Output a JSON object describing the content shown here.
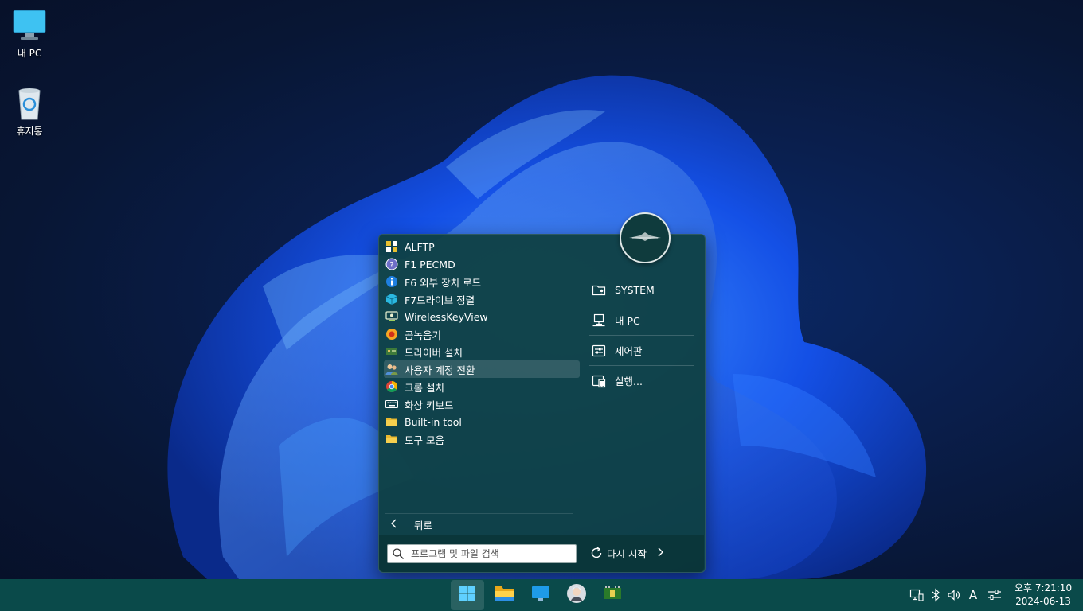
{
  "desktop": {
    "icons": [
      {
        "label": "내 PC",
        "icon": "monitor-icon"
      },
      {
        "label": "휴지통",
        "icon": "recycle-bin-icon"
      }
    ]
  },
  "start_menu": {
    "programs": [
      {
        "label": "ALFTP",
        "icon": "alftp-icon"
      },
      {
        "label": "F1 PECMD",
        "icon": "help-icon"
      },
      {
        "label": "F6 외부 장치 로드",
        "icon": "info-icon"
      },
      {
        "label": "F7드라이브 정렬",
        "icon": "cube-icon"
      },
      {
        "label": "WirelessKeyView",
        "icon": "wireless-key-icon"
      },
      {
        "label": "곰녹음기",
        "icon": "recorder-icon"
      },
      {
        "label": "드라이버 설치",
        "icon": "driver-icon"
      },
      {
        "label": "사용자 계정 전환",
        "icon": "users-icon"
      },
      {
        "label": "크롬 설치",
        "icon": "chrome-icon"
      },
      {
        "label": "화상 키보드",
        "icon": "keyboard-icon"
      },
      {
        "label": "Built-in tool",
        "icon": "folder-icon"
      },
      {
        "label": "도구 모음",
        "icon": "folder-icon"
      }
    ],
    "highlighted_index": 7,
    "right_items": [
      {
        "label": "SYSTEM",
        "icon": "user-folder-icon"
      },
      {
        "label": "내 PC",
        "icon": "computer-icon"
      },
      {
        "label": "제어판",
        "icon": "control-panel-icon"
      },
      {
        "label": "실행...",
        "icon": "run-icon"
      }
    ],
    "back_label": "뒤로",
    "search_placeholder": "프로그램 및 파일 검색",
    "restart_label": "다시 시작"
  },
  "taskbar": {
    "apps": [
      "start-button",
      "file-explorer",
      "desktop-app",
      "user-app",
      "hardware-app"
    ],
    "clock": {
      "time": "오후 7:21:10",
      "date": "2024-06-13"
    },
    "tray": [
      "network-icon",
      "bluetooth-icon",
      "volume-icon",
      "ime-indicator",
      "settings-sliders-icon"
    ],
    "ime_text": "A"
  },
  "colors": {
    "menu_bg": "#0e4040",
    "taskbar_bg": "#0a4a4a",
    "accent": "#1e6bff"
  }
}
